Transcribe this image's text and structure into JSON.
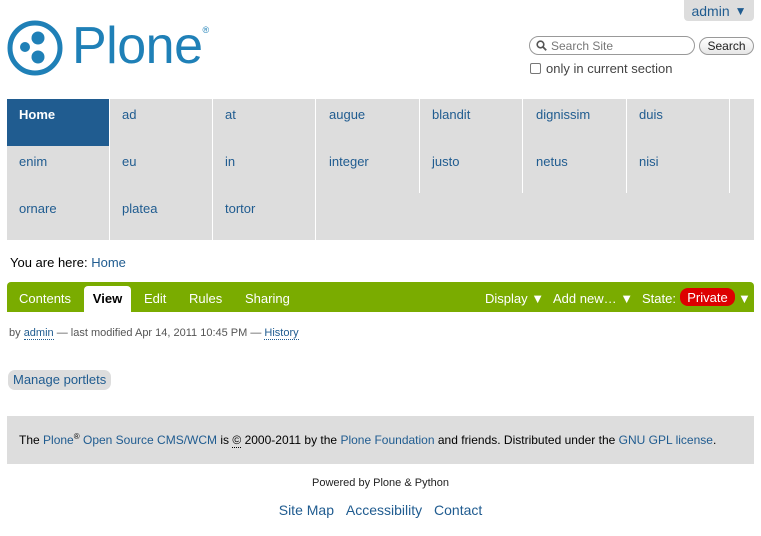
{
  "personal_bar": {
    "user": "admin",
    "arrow": "▼"
  },
  "logo": {
    "text": "Plone",
    "registered": "®"
  },
  "search": {
    "placeholder": "Search Site",
    "button_label": "Search",
    "section_label": "only in current section"
  },
  "nav": {
    "items": [
      {
        "label": "Home",
        "active": true
      },
      {
        "label": "ad"
      },
      {
        "label": "at"
      },
      {
        "label": "augue"
      },
      {
        "label": "blandit"
      },
      {
        "label": "dignissim"
      },
      {
        "label": "duis"
      },
      {
        "label": "enim"
      },
      {
        "label": "eu"
      },
      {
        "label": "in"
      },
      {
        "label": "integer"
      },
      {
        "label": "justo"
      },
      {
        "label": "netus"
      },
      {
        "label": "nisi"
      },
      {
        "label": "ornare"
      },
      {
        "label": "platea"
      },
      {
        "label": "tortor"
      }
    ]
  },
  "breadcrumb": {
    "prefix": "You are here:",
    "home": "Home"
  },
  "editbar": {
    "tabs": {
      "contents": "Contents",
      "view": "View",
      "edit": "Edit",
      "rules": "Rules",
      "sharing": "Sharing"
    },
    "display": "Display ▼",
    "add_new": "Add new… ▼",
    "state_label": "State:",
    "state_value": "Private",
    "state_arrow": "▼"
  },
  "byline": {
    "by": "by",
    "author": "admin",
    "modified": "— last modified Apr 14, 2011 10:45 PM —",
    "history": "History"
  },
  "manage_portlets": "Manage portlets",
  "footer": {
    "the": "The",
    "plone": "Plone",
    "reg": "®",
    "cms": "Open Source CMS/WCM",
    "is": "is",
    "copy": "©",
    "years": "2000-2011 by the",
    "foundation": "Plone Foundation",
    "and": "and friends. Distributed under the",
    "license": "GNU GPL license",
    "period": "."
  },
  "colophon": "Powered by Plone & Python",
  "site_actions": {
    "sitemap": "Site Map",
    "accessibility": "Accessibility",
    "contact": "Contact"
  },
  "colors": {
    "brand": "#1f80b7",
    "nav_active": "#205c90",
    "editbar": "#7aac00",
    "private": "#dd0000"
  }
}
